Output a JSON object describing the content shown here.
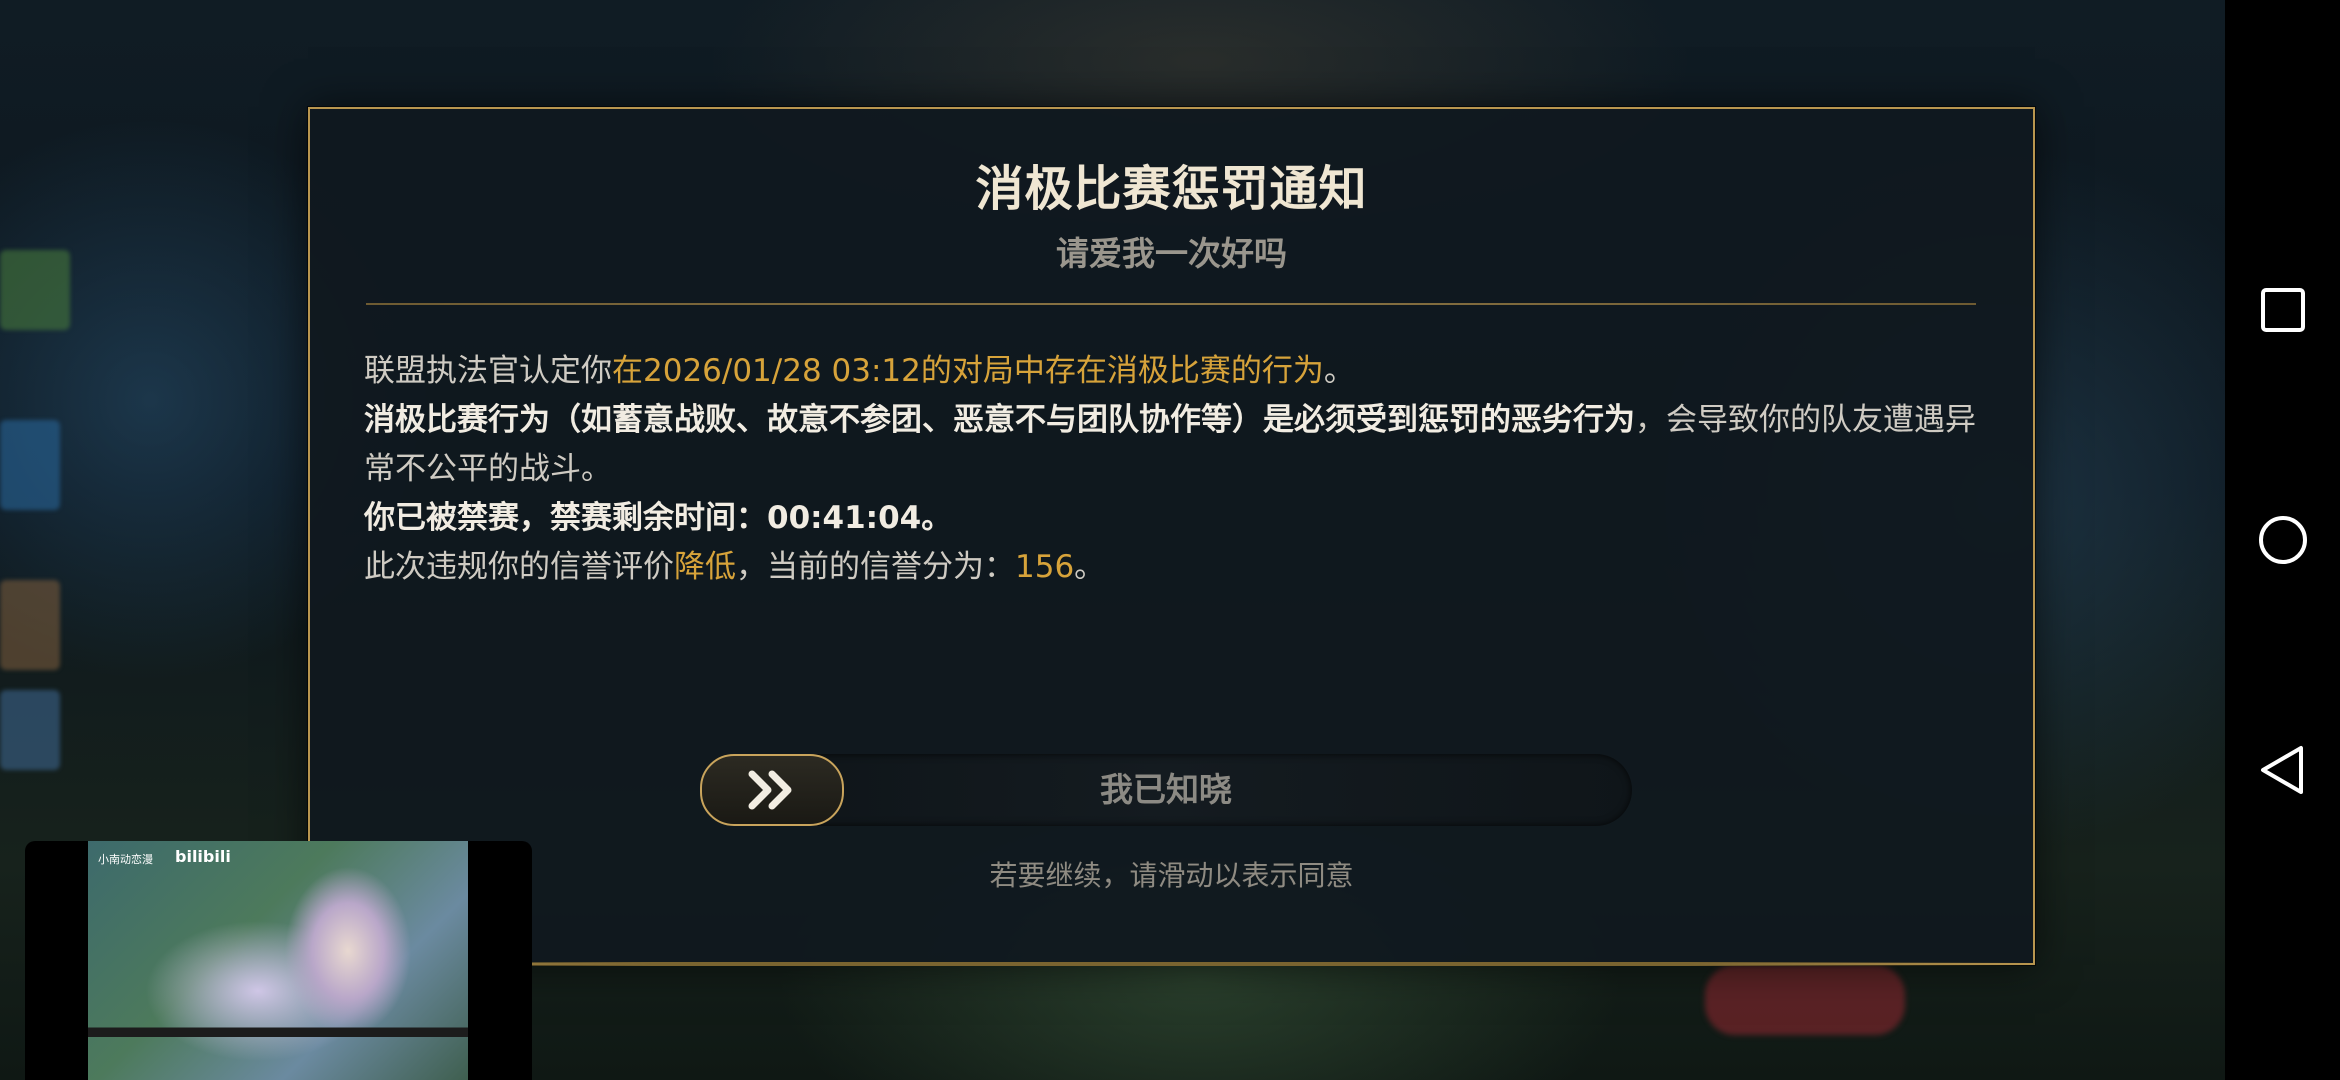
{
  "dialog": {
    "title": "消极比赛惩罚通知",
    "subtitle": "请爱我一次好吗",
    "line1_pre": "联盟执法官认定你",
    "line1_highlight": "在2026/01/28 03:12的对局中存在消极比赛的行为",
    "line1_post": "。",
    "line2_bold": "消极比赛行为（如蓄意战败、故意不参团、恶意不与团队协作等）是必须受到惩罚的恶劣行为",
    "line2_rest": "，会导致你的队友遭遇异常不公平的战斗。",
    "line3_bold": "你已被禁赛，禁赛剩余时间：00:41:04。",
    "line4_pre": "此次违规你的信誉评价",
    "line4_highlight": "降低",
    "line4_mid": "，当前的信誉分为：",
    "line4_score": "156",
    "line4_post": "。",
    "slider_label": "我已知晓",
    "slider_icon": "double-chevron-right-icon",
    "hint": "若要继续，请滑动以表示同意"
  },
  "video_overlay": {
    "caption": "小南动恋漫",
    "brand": "bilibili"
  },
  "navbar": {
    "icons": [
      "square-icon",
      "circle-icon",
      "back-triangle-icon"
    ]
  },
  "colors": {
    "accent_gold": "#d7a33a",
    "border_gold": "#b9964f",
    "dialog_bg": "#10181f"
  }
}
